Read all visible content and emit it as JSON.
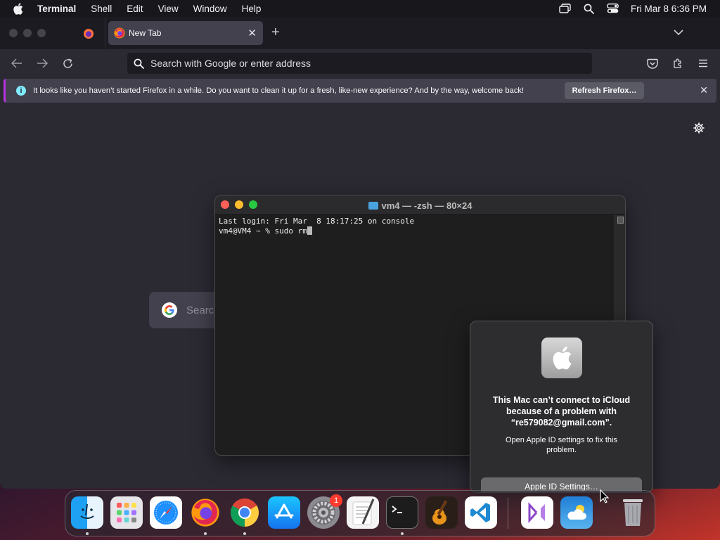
{
  "menubar": {
    "app_name": "Terminal",
    "items": [
      "Shell",
      "Edit",
      "View",
      "Window",
      "Help"
    ],
    "clock": "Fri Mar 8  6:36 PM"
  },
  "firefox": {
    "active_tab_title": "New Tab",
    "search_placeholder": "Search with Google or enter address",
    "notification": {
      "message": "It looks like you haven’t started Firefox in a while. Do you want to clean it up for a fresh, like-new experience? And by the way, welcome back!",
      "button": "Refresh Firefox…"
    },
    "google_search_placeholder": "Search"
  },
  "terminal": {
    "title": "vm4 — -zsh — 80×24",
    "lines": [
      "Last login: Fri Mar  8 18:17:25 on console",
      "vm4@VM4 ~ % sudo rm"
    ]
  },
  "alert": {
    "heading": "This Mac can’t connect to iCloud because of a problem with “re579082@gmail.com”.",
    "subtext": "Open Apple ID settings to fix this problem.",
    "button": "Apple ID Settings…"
  },
  "dock": {
    "apps": [
      "Finder",
      "Launchpad",
      "Safari",
      "Firefox",
      "Google Chrome",
      "App Store",
      "System Settings",
      "TextEdit",
      "Terminal",
      "GarageBand",
      "Visual Studio Code",
      "Visual Studio",
      "Weather",
      "Trash"
    ],
    "settings_badge": "1"
  },
  "colors": {
    "ff_toolbar": "#2b2a33",
    "ff_tabbar": "#1c1b22",
    "notice_accent": "#b833e1",
    "terminal_bg": "#1e1e1e",
    "close": "#ff5f57",
    "minimize": "#febc2e",
    "zoom": "#28c840"
  }
}
